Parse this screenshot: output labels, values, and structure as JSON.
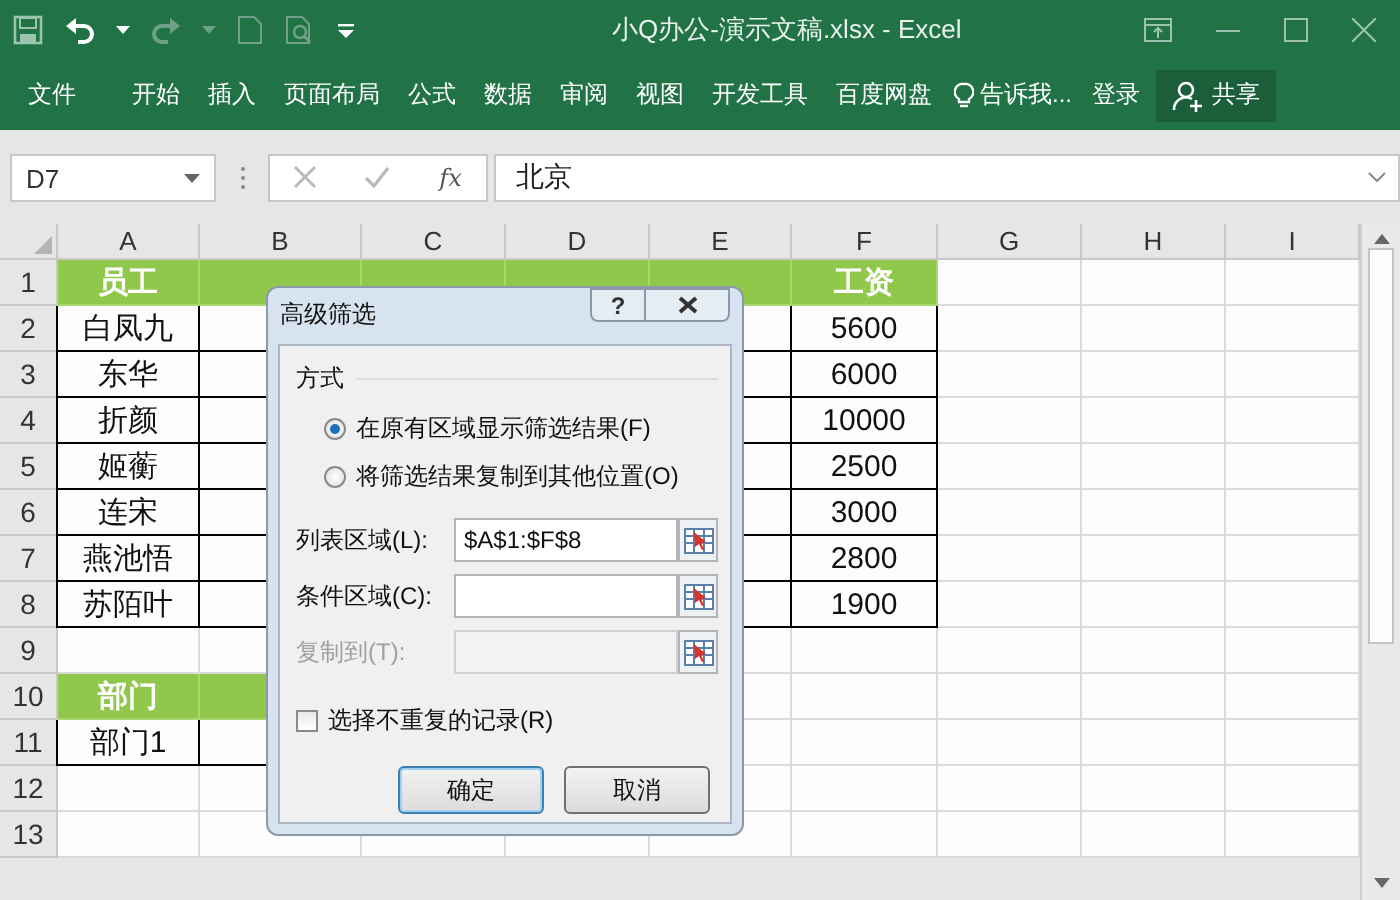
{
  "title_bar": {
    "title": "小Q办公-演示文稿.xlsx - Excel"
  },
  "ribbon": {
    "tabs": [
      {
        "label": "文件"
      },
      {
        "label": "开始"
      },
      {
        "label": "插入"
      },
      {
        "label": "页面布局"
      },
      {
        "label": "公式"
      },
      {
        "label": "数据"
      },
      {
        "label": "审阅"
      },
      {
        "label": "视图"
      },
      {
        "label": "开发工具"
      },
      {
        "label": "百度网盘"
      }
    ],
    "tell_me": "告诉我...",
    "sign_in": "登录",
    "share": "共享"
  },
  "formula_bar": {
    "name_box": "D7",
    "function_label": "fx",
    "formula": "北京"
  },
  "sheet": {
    "columns": [
      "A",
      "B",
      "C",
      "D",
      "E",
      "F",
      "G",
      "H",
      "I"
    ],
    "rows": [
      {
        "number": "1",
        "cells": [
          {
            "kind": "header",
            "text": "员工"
          },
          {
            "kind": "header"
          },
          {
            "kind": "header"
          },
          {
            "kind": "header"
          },
          {
            "kind": "header"
          },
          {
            "kind": "header",
            "text": "工资"
          }
        ]
      },
      {
        "number": "2",
        "cells": [
          {
            "kind": "data",
            "text": "白凤九"
          },
          {
            "kind": "data"
          },
          {
            "kind": "data"
          },
          {
            "kind": "data"
          },
          {
            "kind": "data"
          },
          {
            "kind": "data",
            "text": "5600"
          }
        ]
      },
      {
        "number": "3",
        "cells": [
          {
            "kind": "data",
            "text": "东华"
          },
          {
            "kind": "data"
          },
          {
            "kind": "data"
          },
          {
            "kind": "data"
          },
          {
            "kind": "data"
          },
          {
            "kind": "data",
            "text": "6000"
          }
        ]
      },
      {
        "number": "4",
        "cells": [
          {
            "kind": "data",
            "text": "折颜"
          },
          {
            "kind": "data"
          },
          {
            "kind": "data"
          },
          {
            "kind": "data"
          },
          {
            "kind": "data"
          },
          {
            "kind": "data",
            "text": "10000"
          }
        ]
      },
      {
        "number": "5",
        "cells": [
          {
            "kind": "data",
            "text": "姬蘅"
          },
          {
            "kind": "data"
          },
          {
            "kind": "data"
          },
          {
            "kind": "data"
          },
          {
            "kind": "data"
          },
          {
            "kind": "data",
            "text": "2500"
          }
        ]
      },
      {
        "number": "6",
        "cells": [
          {
            "kind": "data",
            "text": "连宋"
          },
          {
            "kind": "data"
          },
          {
            "kind": "data"
          },
          {
            "kind": "data"
          },
          {
            "kind": "data"
          },
          {
            "kind": "data",
            "text": "3000"
          }
        ]
      },
      {
        "number": "7",
        "cells": [
          {
            "kind": "data",
            "text": "燕池悟"
          },
          {
            "kind": "data"
          },
          {
            "kind": "data"
          },
          {
            "kind": "data"
          },
          {
            "kind": "data"
          },
          {
            "kind": "data",
            "text": "2800"
          }
        ]
      },
      {
        "number": "8",
        "cells": [
          {
            "kind": "data",
            "text": "苏陌叶"
          },
          {
            "kind": "data"
          },
          {
            "kind": "data"
          },
          {
            "kind": "data"
          },
          {
            "kind": "data"
          },
          {
            "kind": "data",
            "text": "1900"
          }
        ]
      },
      {
        "number": "9"
      },
      {
        "number": "10",
        "cells": [
          {
            "kind": "header",
            "text": "部门"
          },
          {
            "kind": "header"
          }
        ]
      },
      {
        "number": "11",
        "cells": [
          {
            "kind": "data",
            "text": "部门1"
          },
          {
            "kind": "data"
          }
        ]
      },
      {
        "number": "12"
      },
      {
        "number": "13"
      }
    ]
  },
  "dialog": {
    "title": "高级筛选",
    "help": "?",
    "group_label": "方式",
    "actions": [
      {
        "label": "在原有区域显示筛选结果(F)",
        "selected": true
      },
      {
        "label": "将筛选结果复制到其他位置(O)",
        "selected": false
      }
    ],
    "fields": [
      {
        "label": "列表区域(L):",
        "value": "$A$1:$F$8",
        "disabled": false
      },
      {
        "label": "条件区域(C):",
        "disabled": false
      },
      {
        "label": "复制到(T):",
        "disabled": true
      }
    ],
    "unique_records": {
      "label": "选择不重复的记录(R)",
      "checked": false
    },
    "buttons": [
      {
        "label": "确定",
        "default": true
      },
      {
        "label": "取消",
        "default": false
      }
    ]
  }
}
